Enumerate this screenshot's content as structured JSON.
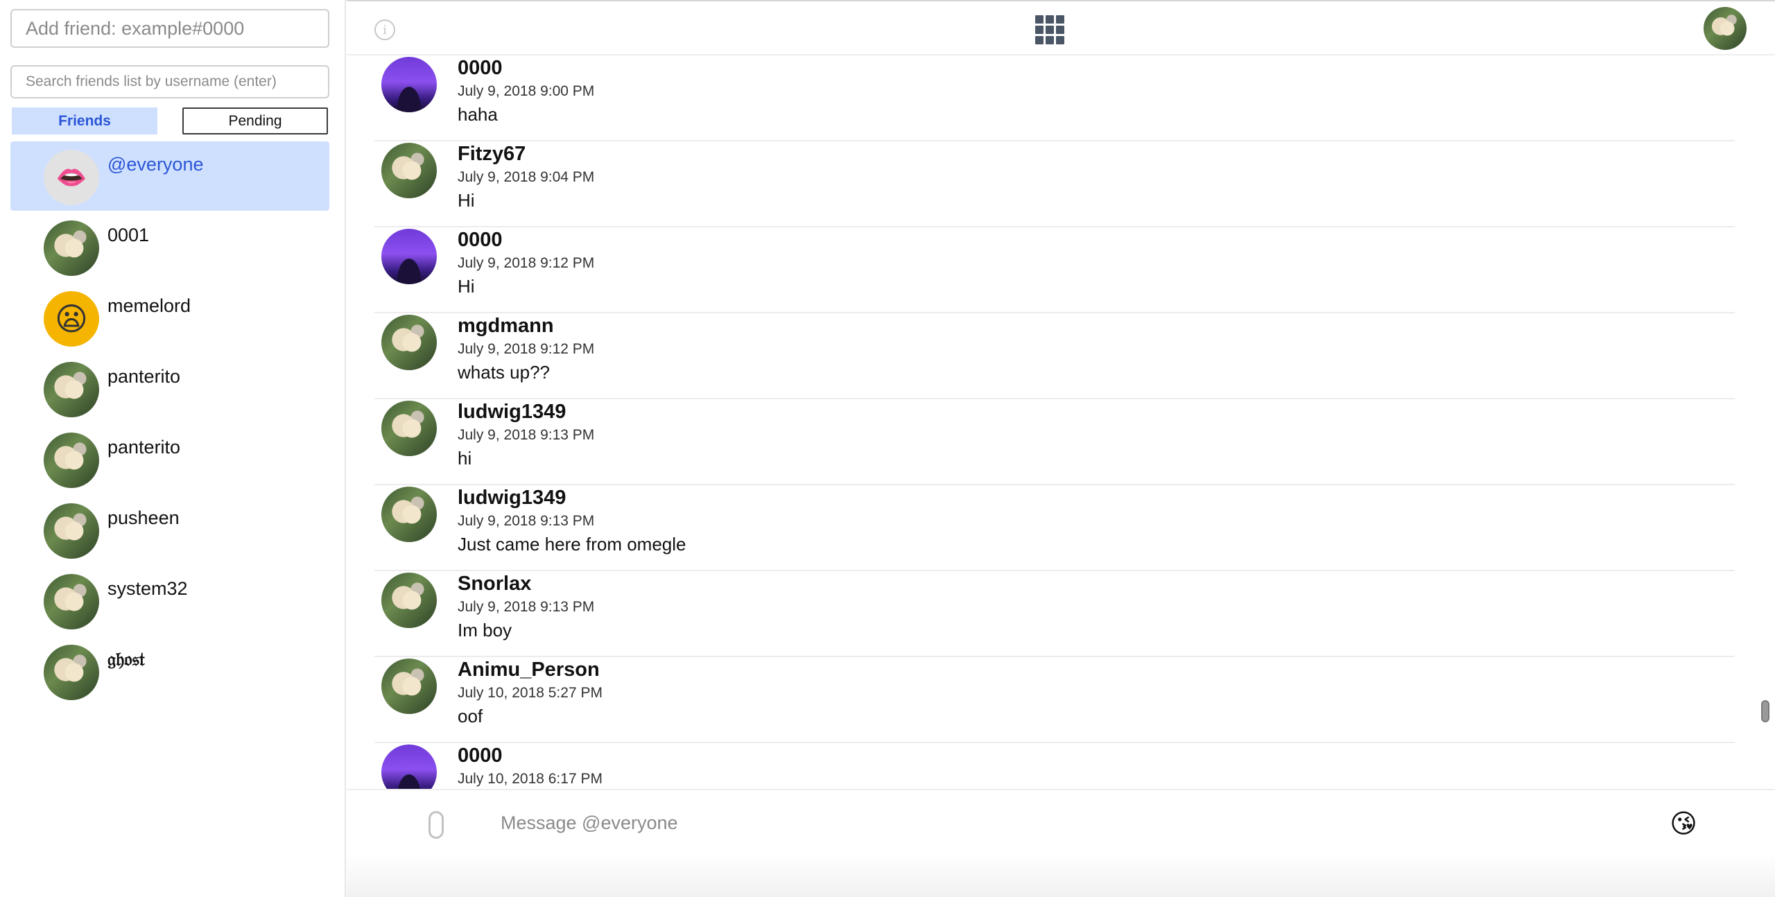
{
  "sidebar": {
    "add_friend_placeholder": "Add friend: example#0000",
    "search_placeholder": "Search friends list by username (enter)",
    "tabs": {
      "friends": "Friends",
      "pending": "Pending"
    },
    "friends": [
      {
        "name": "@everyone",
        "avatar": "lips-emoji"
      },
      {
        "name": "0001",
        "avatar": "dog-photo"
      },
      {
        "name": "memelord",
        "avatar": "anguished-emoji"
      },
      {
        "name": "panterito",
        "avatar": "dog-photo"
      },
      {
        "name": "panterito",
        "avatar": "dog-photo"
      },
      {
        "name": "pusheen",
        "avatar": "dog-photo"
      },
      {
        "name": "system32",
        "avatar": "dog-photo"
      },
      {
        "name": "𝔤𝔥𝔬𝔰𝔱",
        "avatar": "dog-photo"
      }
    ]
  },
  "topbar": {
    "info_icon": "info-icon",
    "apps_icon": "grid-icon"
  },
  "messages": [
    {
      "author": "0000",
      "time": "July 9, 2018 9:00 PM",
      "text": "haha",
      "avatar": "purple-night"
    },
    {
      "author": "Fitzy67",
      "time": "July 9, 2018 9:04 PM",
      "text": "Hi",
      "avatar": "dog-photo"
    },
    {
      "author": "0000",
      "time": "July 9, 2018 9:12 PM",
      "text": "Hi",
      "avatar": "purple-night"
    },
    {
      "author": "mgdmann",
      "time": "July 9, 2018 9:12 PM",
      "text": "whats up??",
      "avatar": "dog-photo"
    },
    {
      "author": "ludwig1349",
      "time": "July 9, 2018 9:13 PM",
      "text": "hi",
      "avatar": "dog-photo"
    },
    {
      "author": "ludwig1349",
      "time": "July 9, 2018 9:13 PM",
      "text": "Just came here from omegle",
      "avatar": "dog-photo"
    },
    {
      "author": "Snorlax",
      "time": "July 9, 2018 9:13 PM",
      "text": "Im boy",
      "avatar": "dog-photo"
    },
    {
      "author": "Animu_Person",
      "time": "July 10, 2018 5:27 PM",
      "text": "oof",
      "avatar": "dog-photo"
    },
    {
      "author": "0000",
      "time": "July 10, 2018 6:17 PM",
      "text": "",
      "avatar": "purple-night"
    }
  ],
  "composer": {
    "placeholder": "Message @everyone",
    "emoji": "😘"
  },
  "colors": {
    "accent": "#2b56d6",
    "selected_bg": "#cfe0ff"
  }
}
